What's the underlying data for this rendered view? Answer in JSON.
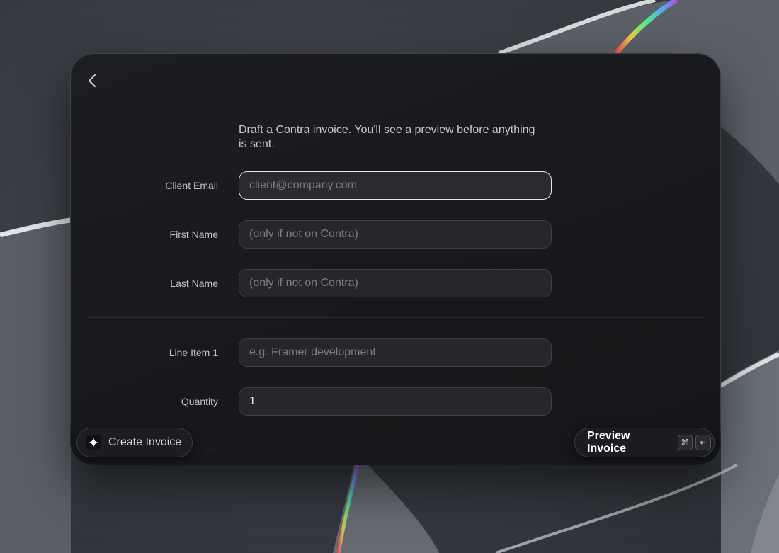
{
  "intro": {
    "text": "Draft a Contra invoice. You'll see a preview before anything is sent."
  },
  "form": {
    "client_email": {
      "label": "Client Email",
      "placeholder": "client@company.com",
      "value": ""
    },
    "first_name": {
      "label": "First Name",
      "placeholder": "(only if not on Contra)",
      "value": ""
    },
    "last_name": {
      "label": "Last Name",
      "placeholder": "(only if not on Contra)",
      "value": ""
    },
    "line_item_1": {
      "label": "Line Item 1",
      "placeholder": "e.g. Framer development",
      "value": ""
    },
    "quantity": {
      "label": "Quantity",
      "value": "1"
    },
    "rate": {
      "label": "Rate",
      "placeholder": "150",
      "value": ""
    }
  },
  "actions": {
    "create_label": "Create Invoice",
    "preview_label": "Preview Invoice",
    "shortcut_keys": [
      "⌘",
      "↵"
    ]
  },
  "icons": {
    "back": "chevron-left-icon",
    "create": "sparkle-icon",
    "command": "command-key-icon",
    "enter": "return-key-icon"
  },
  "colors": {
    "panel": "#1a1b1e",
    "field_bg": "#26272b",
    "field_border": "#3e3f44",
    "focus_border": "#e6e6e8"
  }
}
